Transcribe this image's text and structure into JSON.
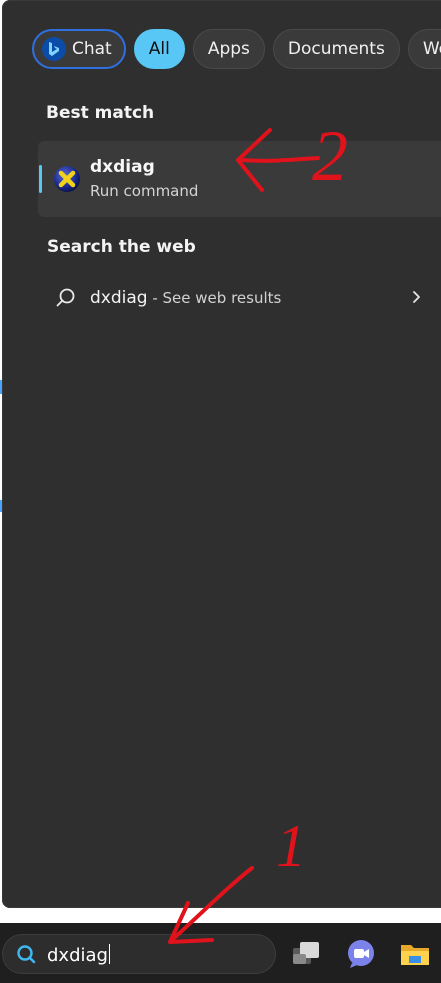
{
  "filter_tabs": {
    "chat": "Chat",
    "all": "All",
    "apps": "Apps",
    "documents": "Documents",
    "web": "Web"
  },
  "best_match": {
    "heading": "Best match",
    "app_name": "dxdiag",
    "app_type": "Run command"
  },
  "search_web": {
    "heading": "Search the web",
    "query": "dxdiag",
    "separator": " - ",
    "suffix": "See web results"
  },
  "taskbar": {
    "search_value": "dxdiag"
  },
  "annotations": {
    "label_1": "1",
    "label_2": "2",
    "arrow_color": "#e0121b"
  },
  "colors": {
    "accent": "#58c7f5",
    "panel_bg": "#2f2f2f",
    "chat_border": "#2f6fe0"
  }
}
